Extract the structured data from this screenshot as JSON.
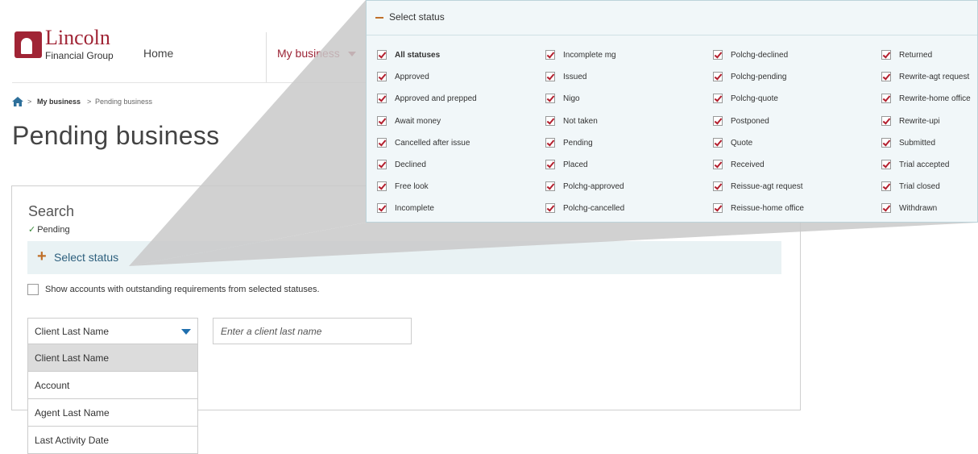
{
  "header": {
    "logo_name": "Lincoln",
    "logo_sub": "Financial Group",
    "nav_home": "Home",
    "nav_business": "My business"
  },
  "breadcrumb": {
    "item1": "My business",
    "sep": ">",
    "item2": "Pending business"
  },
  "page_title": "Pending business",
  "search": {
    "label": "Search",
    "pending_tag": "Pending",
    "select_status": "Select status",
    "outstanding": "Show accounts with outstanding requirements from selected statuses.",
    "dropdown_value": "Client Last Name",
    "input_placeholder": "Enter a client last name",
    "options": [
      "Client Last Name",
      "Account",
      "Agent Last Name",
      "Last Activity Date"
    ]
  },
  "status_popup": {
    "title": "Select status",
    "columns": [
      [
        "All statuses",
        "Approved",
        "Approved and prepped",
        "Await money",
        "Cancelled after issue",
        "Declined",
        "Free look",
        "Incomplete"
      ],
      [
        "Incomplete mg",
        "Issued",
        "Nigo",
        "Not taken",
        "Pending",
        "Placed",
        "Polchg-approved",
        "Polchg-cancelled"
      ],
      [
        "Polchg-declined",
        "Polchg-pending",
        "Polchg-quote",
        "Postponed",
        "Quote",
        "Received",
        "Reissue-agt request",
        "Reissue-home office"
      ],
      [
        "Returned",
        "Rewrite-agt request",
        "Rewrite-home office",
        "Rewrite-upi",
        "Submitted",
        "Trial accepted",
        "Trial closed",
        "Withdrawn"
      ]
    ]
  },
  "colors": {
    "brand": "#a02435",
    "link": "#2d5f7d",
    "accent": "#c0702a",
    "check": "#b31f2e"
  }
}
